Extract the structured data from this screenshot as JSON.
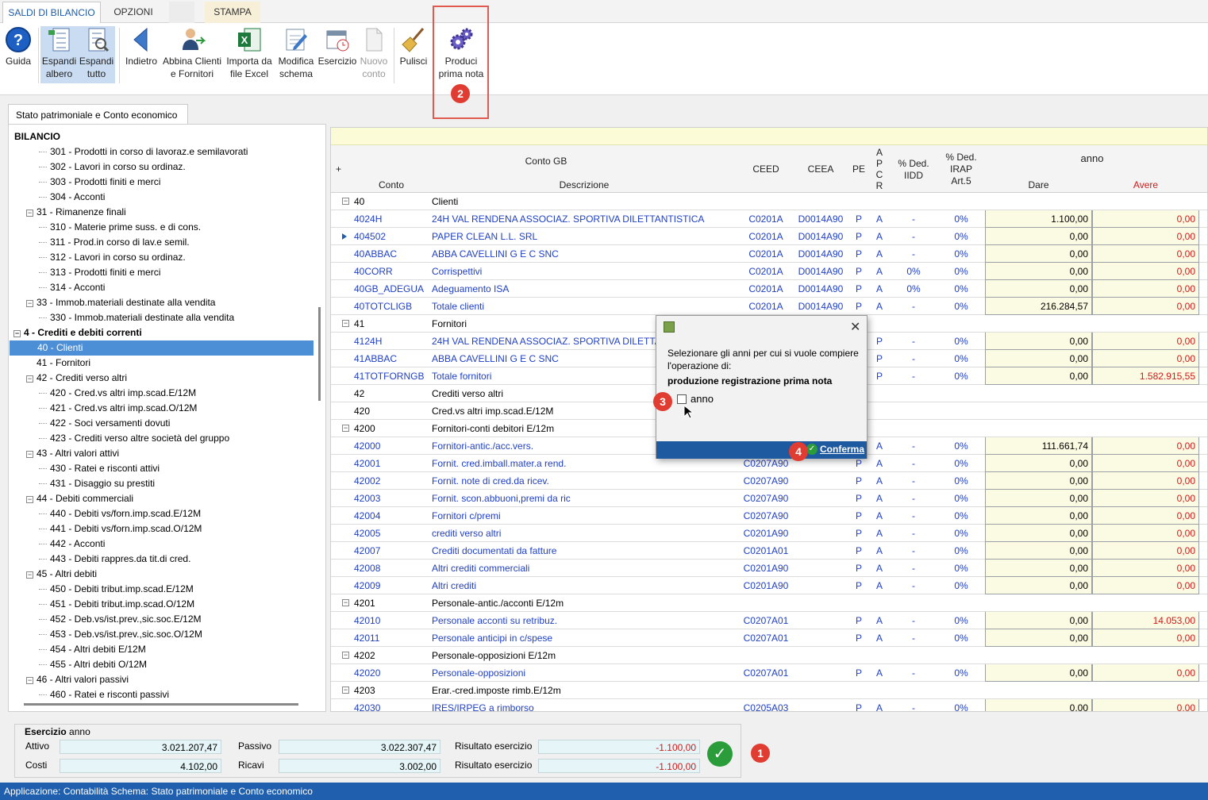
{
  "ribbon_tabs": [
    "SALDI DI BILANCIO",
    "OPZIONI",
    "",
    "STAMPA"
  ],
  "toolbar": {
    "guida": "Guida",
    "espandi_albero": [
      "Espandi",
      "albero"
    ],
    "espandi_tutto": [
      "Espandi",
      "tutto"
    ],
    "indietro": "Indietro",
    "abbina": [
      "Abbina Clienti",
      "e Fornitori"
    ],
    "importa": [
      "Importa da",
      "file Excel"
    ],
    "modifica": [
      "Modifica",
      "schema"
    ],
    "esercizio": "Esercizio",
    "nuovo_conto": [
      "Nuovo",
      "conto"
    ],
    "pulisci": "Pulisci",
    "produci": [
      "Produci",
      "prima nota"
    ]
  },
  "badges": {
    "b1": "1",
    "b2": "2",
    "b3": "3",
    "b4": "4"
  },
  "page_tab": "Stato patrimoniale e Conto economico",
  "tree": {
    "root": "BILANCIO",
    "items": [
      {
        "label": "301 - Prodotti in corso di lavoraz.e semilavorati",
        "level": 3
      },
      {
        "label": "302 - Lavori in corso su ordinaz.",
        "level": 3
      },
      {
        "label": "303 - Prodotti finiti e merci",
        "level": 3
      },
      {
        "label": "304 - Acconti",
        "level": 3
      },
      {
        "label": "31 - Rimanenze finali",
        "level": 2,
        "exp": true
      },
      {
        "label": "310 - Materie prime suss. e di cons.",
        "level": 3
      },
      {
        "label": "311 - Prod.in corso di lav.e semil.",
        "level": 3
      },
      {
        "label": "312 - Lavori in corso su ordinaz.",
        "level": 3
      },
      {
        "label": "313 - Prodotti finiti e merci",
        "level": 3
      },
      {
        "label": "314 - Acconti",
        "level": 3
      },
      {
        "label": "33 - Immob.materiali destinate alla vendita",
        "level": 2,
        "exp": true
      },
      {
        "label": "330 - Immob.materiali destinate alla vendita",
        "level": 3
      },
      {
        "label": "4 - Crediti e debiti correnti",
        "level": 1,
        "exp": true,
        "bold": true
      },
      {
        "label": "40 - Clienti",
        "level": 2,
        "selected": true
      },
      {
        "label": "41 - Fornitori",
        "level": 2
      },
      {
        "label": "42 - Crediti verso altri",
        "level": 2,
        "exp": true
      },
      {
        "label": "420 - Cred.vs altri imp.scad.E/12M",
        "level": 3
      },
      {
        "label": "421 - Cred.vs altri imp.scad.O/12M",
        "level": 3
      },
      {
        "label": "422 - Soci versamenti dovuti",
        "level": 3
      },
      {
        "label": "423 - Crediti verso altre società del gruppo",
        "level": 3
      },
      {
        "label": "43 - Altri valori attivi",
        "level": 2,
        "exp": true
      },
      {
        "label": "430 - Ratei e risconti attivi",
        "level": 3
      },
      {
        "label": "431 - Disaggio su prestiti",
        "level": 3
      },
      {
        "label": "44 - Debiti commerciali",
        "level": 2,
        "exp": true
      },
      {
        "label": "440 - Debiti vs/forn.imp.scad.E/12M",
        "level": 3
      },
      {
        "label": "441 - Debiti vs/forn.imp.scad.O/12M",
        "level": 3
      },
      {
        "label": "442 - Acconti",
        "level": 3
      },
      {
        "label": "443 - Debiti rappres.da tit.di cred.",
        "level": 3
      },
      {
        "label": "45 - Altri debiti",
        "level": 2,
        "exp": true
      },
      {
        "label": "450 - Debiti tribut.imp.scad.E/12M",
        "level": 3
      },
      {
        "label": "451 - Debiti tribut.imp.scad.O/12M",
        "level": 3
      },
      {
        "label": "452 - Deb.vs/ist.prev.,sic.soc.E/12M",
        "level": 3
      },
      {
        "label": "453 - Deb.vs/ist.prev.,sic.soc.O/12M",
        "level": 3
      },
      {
        "label": "454 - Altri debiti E/12M",
        "level": 3
      },
      {
        "label": "455 - Altri debiti O/12M",
        "level": 3
      },
      {
        "label": "46 - Altri valori passivi",
        "level": 2,
        "exp": true
      },
      {
        "label": "460 - Ratei e risconti passivi",
        "level": 3
      }
    ]
  },
  "grid": {
    "header": {
      "plus": "+",
      "conto_gb": "Conto GB",
      "conto": "Conto",
      "descrizione": "Descrizione",
      "ceed": "CEED",
      "ceea": "CEEA",
      "pe": "PE",
      "apcr": [
        "A",
        "P",
        "C",
        "R"
      ],
      "ded_iidd": [
        "% Ded.",
        "IIDD"
      ],
      "ded_irap": [
        "% Ded.",
        "IRAP",
        "Art.5"
      ],
      "anno": "anno",
      "dare": "Dare",
      "avere": "Avere"
    },
    "rows": [
      {
        "group": true,
        "conto": "40",
        "desc": "Clienti"
      },
      {
        "conto": "4024H",
        "desc": "24H VAL RENDENA ASSOCIAZ. SPORTIVA DILETTANTISTICA",
        "ceed": "C0201A",
        "ceea": "D0014A90",
        "pe": "P",
        "apcr": "A",
        "iidd": "-",
        "irap": "0%",
        "dare": "1.100,00",
        "avere": "0,00"
      },
      {
        "conto": "404502",
        "desc": "PAPER CLEAN L.L. SRL",
        "ceed": "C0201A",
        "ceea": "D0014A90",
        "pe": "P",
        "apcr": "A",
        "iidd": "-",
        "irap": "0%",
        "dare": "0,00",
        "avere": "0,00",
        "marker": true
      },
      {
        "conto": "40ABBAC",
        "desc": "ABBA CAVELLINI G E C SNC",
        "ceed": "C0201A",
        "ceea": "D0014A90",
        "pe": "P",
        "apcr": "A",
        "iidd": "-",
        "irap": "0%",
        "dare": "0,00",
        "avere": "0,00"
      },
      {
        "conto": "40CORR",
        "desc": "Corrispettivi",
        "ceed": "C0201A",
        "ceea": "D0014A90",
        "pe": "P",
        "apcr": "A",
        "iidd": "0%",
        "irap": "0%",
        "dare": "0,00",
        "avere": "0,00"
      },
      {
        "conto": "40GB_ADEGUA",
        "desc": "Adeguamento ISA",
        "ceed": "C0201A",
        "ceea": "D0014A90",
        "pe": "P",
        "apcr": "A",
        "iidd": "0%",
        "irap": "0%",
        "dare": "0,00",
        "avere": "0,00"
      },
      {
        "conto": "40TOTCLIGB",
        "desc": "Totale clienti",
        "ceed": "C0201A",
        "ceea": "D0014A90",
        "pe": "P",
        "apcr": "A",
        "iidd": "-",
        "irap": "0%",
        "dare": "216.284,57",
        "avere": "0,00"
      },
      {
        "group": true,
        "conto": "41",
        "desc": "Fornitori"
      },
      {
        "conto": "4124H",
        "desc": "24H VAL RENDENA ASSOCIAZ. SPORTIVA DILETTANTISTICA",
        "ceed": "",
        "ceea": "",
        "pe": "",
        "apcr": "P",
        "iidd": "-",
        "irap": "0%",
        "dare": "0,00",
        "avere": "0,00"
      },
      {
        "conto": "41ABBAC",
        "desc": "ABBA CAVELLINI G E C SNC",
        "ceed": "",
        "ceea": "",
        "pe": "",
        "apcr": "P",
        "iidd": "-",
        "irap": "0%",
        "dare": "0,00",
        "avere": "0,00"
      },
      {
        "conto": "41TOTFORNGB",
        "desc": "Totale fornitori",
        "ceed": "",
        "ceea": "",
        "pe": "",
        "apcr": "P",
        "iidd": "-",
        "irap": "0%",
        "dare": "0,00",
        "avere": "1.582.915,55",
        "avere_red": true
      },
      {
        "sub": true,
        "conto": "42",
        "desc": "Crediti verso altri"
      },
      {
        "sub": true,
        "conto": "420",
        "desc": "Cred.vs altri imp.scad.E/12M"
      },
      {
        "group": true,
        "conto": "4200",
        "desc": "Fornitori-conti debitori E/12m"
      },
      {
        "conto": "42000",
        "desc": "Fornitori-antic./acc.vers.",
        "ceed": "",
        "ceea": "",
        "pe": "",
        "apcr": "A",
        "iidd": "-",
        "irap": "0%",
        "dare": "111.661,74",
        "avere": "0,00"
      },
      {
        "conto": "42001",
        "desc": "Fornit. cred.imball.mater.a rend.",
        "ceed": "C0207A90",
        "ceea": "",
        "pe": "P",
        "apcr": "A",
        "iidd": "-",
        "irap": "0%",
        "dare": "0,00",
        "avere": "0,00"
      },
      {
        "conto": "42002",
        "desc": "Fornit. note di cred.da ricev.",
        "ceed": "C0207A90",
        "ceea": "",
        "pe": "P",
        "apcr": "A",
        "iidd": "-",
        "irap": "0%",
        "dare": "0,00",
        "avere": "0,00"
      },
      {
        "conto": "42003",
        "desc": "Fornit. scon.abbuoni,premi da ric",
        "ceed": "C0207A90",
        "ceea": "",
        "pe": "P",
        "apcr": "A",
        "iidd": "-",
        "irap": "0%",
        "dare": "0,00",
        "avere": "0,00"
      },
      {
        "conto": "42004",
        "desc": "Fornitori c/premi",
        "ceed": "C0207A90",
        "ceea": "",
        "pe": "P",
        "apcr": "A",
        "iidd": "-",
        "irap": "0%",
        "dare": "0,00",
        "avere": "0,00"
      },
      {
        "conto": "42005",
        "desc": "crediti verso altri",
        "ceed": "C0201A90",
        "ceea": "",
        "pe": "P",
        "apcr": "A",
        "iidd": "-",
        "irap": "0%",
        "dare": "0,00",
        "avere": "0,00"
      },
      {
        "conto": "42007",
        "desc": "Crediti documentati da fatture",
        "ceed": "C0201A01",
        "ceea": "",
        "pe": "P",
        "apcr": "A",
        "iidd": "-",
        "irap": "0%",
        "dare": "0,00",
        "avere": "0,00"
      },
      {
        "conto": "42008",
        "desc": "Altri crediti commerciali",
        "ceed": "C0201A90",
        "ceea": "",
        "pe": "P",
        "apcr": "A",
        "iidd": "-",
        "irap": "0%",
        "dare": "0,00",
        "avere": "0,00"
      },
      {
        "conto": "42009",
        "desc": "Altri crediti",
        "ceed": "C0201A90",
        "ceea": "",
        "pe": "P",
        "apcr": "A",
        "iidd": "-",
        "irap": "0%",
        "dare": "0,00",
        "avere": "0,00"
      },
      {
        "group": true,
        "conto": "4201",
        "desc": "Personale-antic./acconti E/12m"
      },
      {
        "conto": "42010",
        "desc": "Personale acconti su retribuz.",
        "ceed": "C0207A01",
        "ceea": "",
        "pe": "P",
        "apcr": "A",
        "iidd": "-",
        "irap": "0%",
        "dare": "0,00",
        "avere": "14.053,00",
        "avere_red": true
      },
      {
        "conto": "42011",
        "desc": "Personale anticipi in c/spese",
        "ceed": "C0207A01",
        "ceea": "",
        "pe": "P",
        "apcr": "A",
        "iidd": "-",
        "irap": "0%",
        "dare": "0,00",
        "avere": "0,00"
      },
      {
        "group": true,
        "conto": "4202",
        "desc": "Personale-opposizioni E/12m"
      },
      {
        "conto": "42020",
        "desc": "Personale-opposizioni",
        "ceed": "C0207A01",
        "ceea": "",
        "pe": "P",
        "apcr": "A",
        "iidd": "-",
        "irap": "0%",
        "dare": "0,00",
        "avere": "0,00"
      },
      {
        "group": true,
        "conto": "4203",
        "desc": "Erar.-cred.imposte rimb.E/12m"
      },
      {
        "conto": "42030",
        "desc": "IRES/IRPEG a rimborso",
        "ceed": "C0205A03",
        "ceea": "",
        "pe": "P",
        "apcr": "A",
        "iidd": "-",
        "irap": "0%",
        "dare": "0,00",
        "avere": "0,00"
      }
    ]
  },
  "dialog": {
    "message": "Selezionare gli anni per cui si vuole compiere l'operazione di:",
    "operation": "produzione registrazione prima nota",
    "checkbox_label": "anno",
    "confirm": "Conferma",
    "close": "✕"
  },
  "summary": {
    "title": "Esercizio",
    "year": "anno",
    "attivo_label": "Attivo",
    "attivo": "3.021.207,47",
    "passivo_label": "Passivo",
    "passivo": "3.022.307,47",
    "risultato1_label": "Risultato esercizio",
    "risultato1": "-1.100,00",
    "costi_label": "Costi",
    "costi": "4.102,00",
    "ricavi_label": "Ricavi",
    "ricavi": "3.002,00",
    "risultato2_label": "Risultato esercizio",
    "risultato2": "-1.100,00"
  },
  "status": "Applicazione: Contabilità   Schema: Stato patrimoniale e Conto economico",
  "colors": {
    "accent": "#1e5aa8",
    "highlight_red": "#e03c31",
    "link_blue": "#1f3fc6",
    "avere_red": "#d21a1a"
  }
}
